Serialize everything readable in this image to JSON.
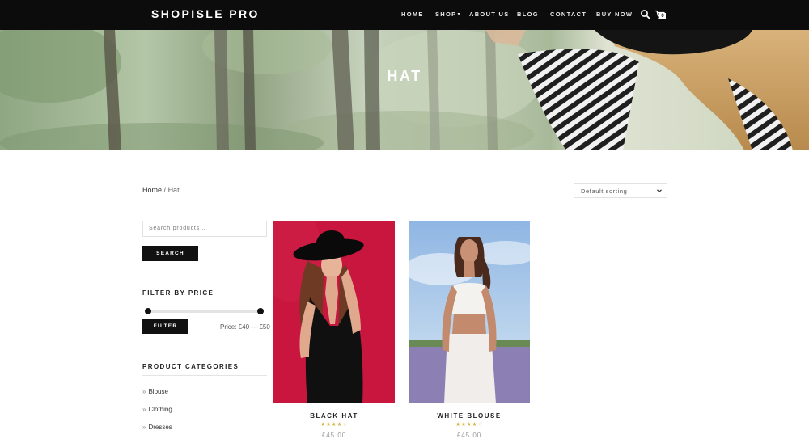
{
  "header": {
    "brand": "SHOPISLE PRO",
    "nav": {
      "home": "HOME",
      "shop": "SHOP",
      "about": "ABOUT US",
      "blog": "BLOG",
      "contact": "CONTACT",
      "buy_now": "BUY NOW"
    },
    "cart_count": "0",
    "icons": [
      "search-icon",
      "cart-icon"
    ]
  },
  "hero": {
    "title": "HAT"
  },
  "breadcrumb": {
    "home": "Home",
    "separator": "/",
    "current": "Hat"
  },
  "sorting": {
    "selected": "Default sorting"
  },
  "sidebar": {
    "search": {
      "placeholder": "Search products…",
      "button": "SEARCH"
    },
    "price_filter": {
      "title": "FILTER BY PRICE",
      "button": "FILTER",
      "range_text": "Price: £40 — £50",
      "min_fraction": 0.0,
      "max_fraction": 1.0
    },
    "categories": {
      "title": "PRODUCT CATEGORIES",
      "items": [
        "Blouse",
        "Clothing",
        "Dresses"
      ]
    }
  },
  "products": [
    {
      "name": "BLACK HAT",
      "rating": 4,
      "price": "£45.00"
    },
    {
      "name": "WHITE BLOUSE",
      "rating": 4,
      "price": "£45.00"
    }
  ],
  "colors": {
    "navbar": "#0c0c0c",
    "button": "#111111",
    "star": "#d4b23a",
    "product1_background": "#c8163f",
    "product2_sky": "#a9c9ea",
    "product2_field": "#8c7fb4"
  }
}
